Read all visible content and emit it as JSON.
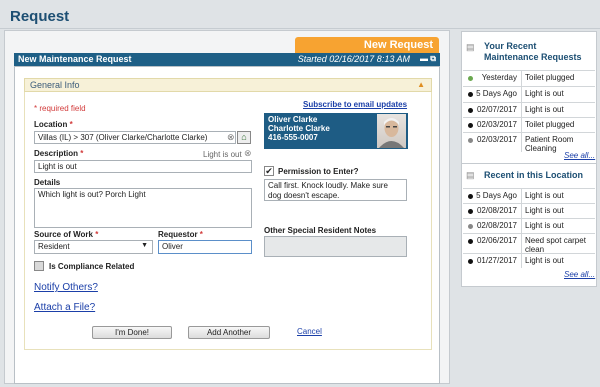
{
  "page": {
    "title": "Request"
  },
  "tab": {
    "new_request": "New Request"
  },
  "form": {
    "header_title": "New Maintenance Request",
    "started": "Started 02/16/2017 8:13 AM",
    "section": "General Info",
    "required_note": "* required field",
    "subscribe_link": "Subscribe to email updates",
    "location_label": "Location",
    "location_value": "Villas (IL) > 307 (Oliver Clarke/Charlotte Clarke)",
    "description_label": "Description",
    "description_hint": "Light is out",
    "description_value": "Light is out",
    "details_label": "Details",
    "details_value": "Which light is out? Porch Light",
    "source_label": "Source of Work",
    "source_value": "Resident",
    "requestor_label": "Requestor",
    "requestor_value": "Oliver",
    "compliance_label": "Is Compliance Related",
    "notify_link": "Notify Others?",
    "attach_link": "Attach a File?",
    "done_button": "I'm Done!",
    "add_another_button": "Add Another",
    "cancel_link": "Cancel",
    "resident": {
      "name1": "Oliver Clarke",
      "name2": "Charlotte Clarke",
      "phone": "416-555-0007"
    },
    "permission_label": "Permission to Enter?",
    "permission_value": "Call first. Knock loudly. Make sure dog doesn't escape.",
    "special_notes_label": "Other Special Resident Notes",
    "special_notes_value": ""
  },
  "recent_requests": {
    "title_line1": "Your Recent",
    "title_line2": "Maintenance Requests",
    "see_all": "See all...",
    "items": [
      {
        "date": "Yesterday",
        "desc": "Toilet plugged",
        "status_color": "#6aa84f"
      },
      {
        "date": "5 Days Ago",
        "desc": "Light is out",
        "status_color": "#111111"
      },
      {
        "date": "02/07/2017",
        "desc": "Light is out",
        "status_color": "#111111"
      },
      {
        "date": "02/03/2017",
        "desc": "Toilet plugged",
        "status_color": "#111111"
      },
      {
        "date": "02/03/2017",
        "desc": "Patient Room Cleaning",
        "status_color": "#888888"
      }
    ]
  },
  "recent_location": {
    "title": "Recent in this Location",
    "see_all": "See all...",
    "items": [
      {
        "date": "5 Days Ago",
        "desc": "Light is out",
        "status_color": "#111111"
      },
      {
        "date": "02/08/2017",
        "desc": "Light is out",
        "status_color": "#111111"
      },
      {
        "date": "02/08/2017",
        "desc": "Light is out",
        "status_color": "#888888"
      },
      {
        "date": "02/06/2017",
        "desc": "Need spot carpet clean",
        "status_color": "#111111"
      },
      {
        "date": "01/27/2017",
        "desc": "Light is out",
        "status_color": "#111111"
      }
    ]
  }
}
